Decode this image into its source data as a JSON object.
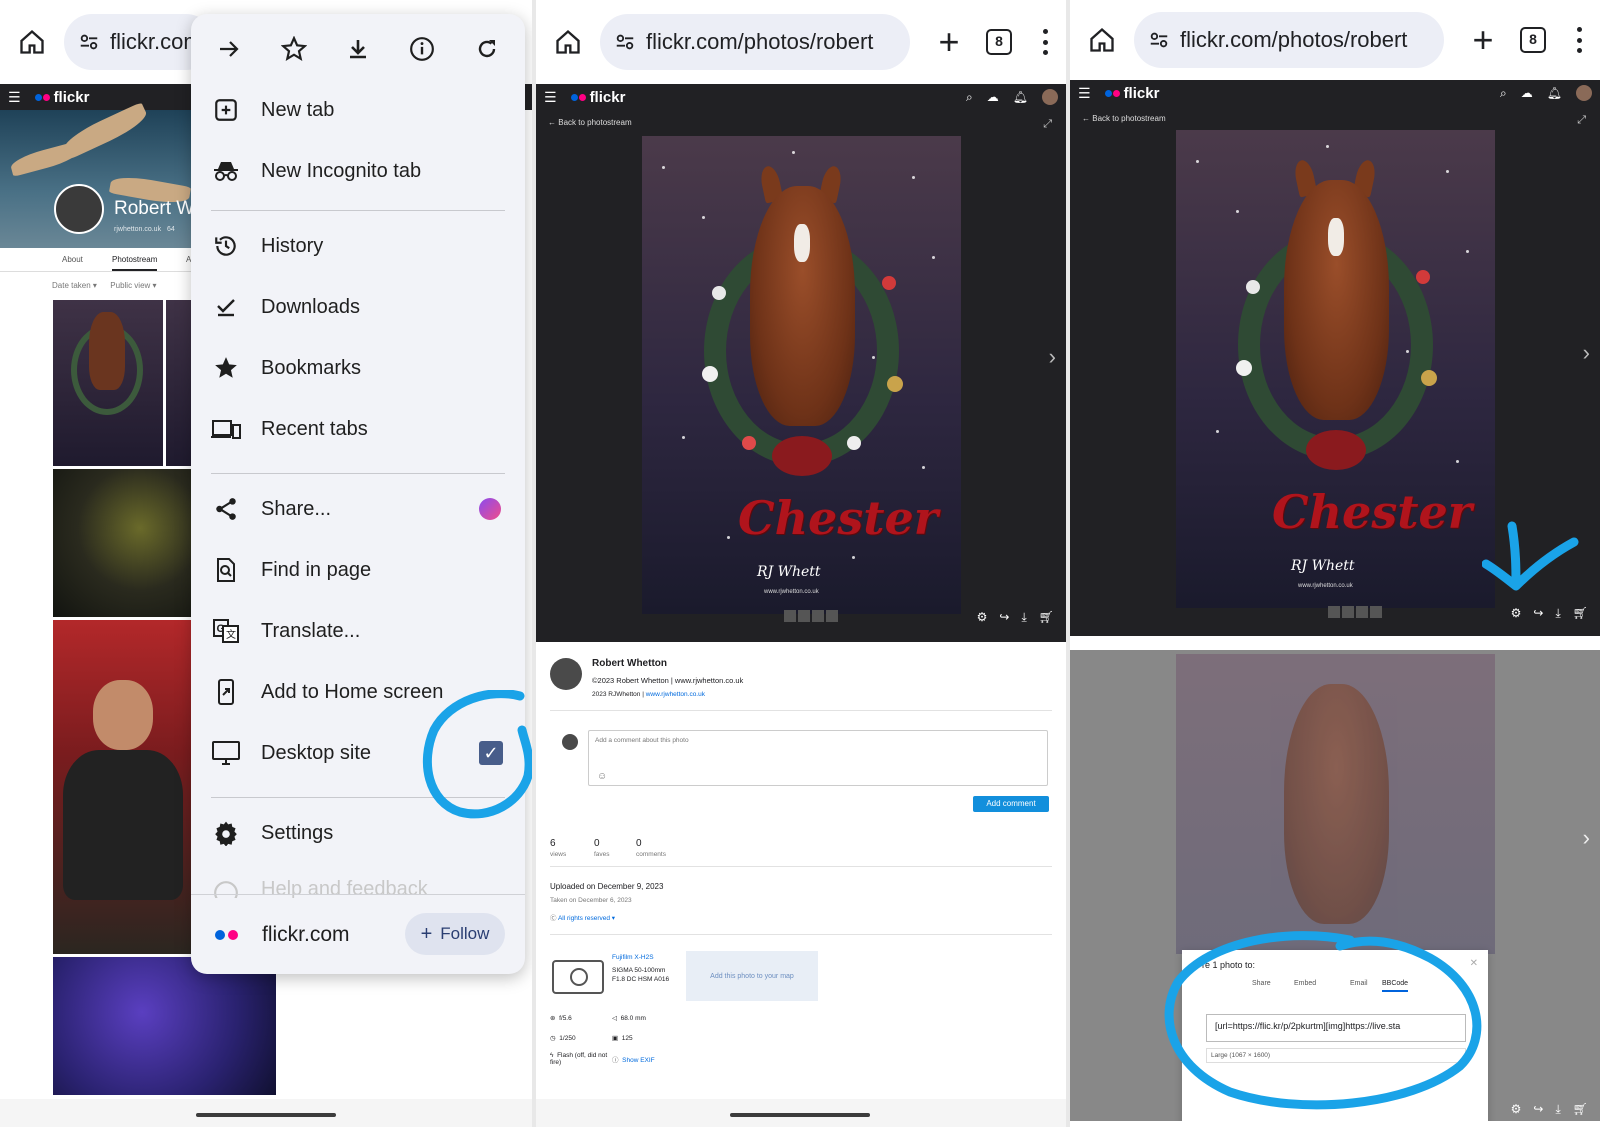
{
  "panel1": {
    "url": "flickr.com",
    "profile": {
      "name": "Robert W",
      "site": "rjwhetton.co.uk",
      "site_count": "64"
    },
    "tabs": [
      "About",
      "Photostream",
      "A"
    ],
    "filters": {
      "date": "Date taken ▾",
      "view": "Public view ▾"
    },
    "menu": {
      "top_icons": [
        "forward-icon",
        "star-icon",
        "download-icon",
        "info-icon",
        "reload-icon"
      ],
      "items": [
        {
          "label": "New tab",
          "icon": "new-tab-icon"
        },
        {
          "label": "New Incognito tab",
          "icon": "incognito-icon"
        },
        {
          "label": "History",
          "icon": "history-icon"
        },
        {
          "label": "Downloads",
          "icon": "downloads-icon"
        },
        {
          "label": "Bookmarks",
          "icon": "bookmarks-icon"
        },
        {
          "label": "Recent tabs",
          "icon": "recent-tabs-icon"
        },
        {
          "label": "Share...",
          "icon": "share-icon"
        },
        {
          "label": "Find in page",
          "icon": "find-icon"
        },
        {
          "label": "Translate...",
          "icon": "translate-icon"
        },
        {
          "label": "Add to Home screen",
          "icon": "add-home-icon"
        },
        {
          "label": "Desktop site",
          "icon": "desktop-icon",
          "checked": true
        },
        {
          "label": "Settings",
          "icon": "settings-icon"
        },
        {
          "label": "Help and feedback",
          "icon": "help-icon"
        }
      ],
      "footer": {
        "site": "flickr.com",
        "follow_label": "Follow"
      }
    }
  },
  "panel2": {
    "url": "flickr.com/photos/robert",
    "tab_count": "8",
    "brand": "flickr",
    "back_label": "Back to photostream",
    "photo": {
      "title_art": "Chester",
      "signature": "RJ Whett",
      "site": "www.rjwhetton.co.uk"
    },
    "owner": {
      "name": "Robert Whetton",
      "copyright": "©2023 Robert Whetton | www.rjwhetton.co.uk",
      "credit_prefix": "2023 RJWhetton |",
      "credit_link": "www.rjwhetton.co.uk"
    },
    "comment_placeholder": "Add a comment about this photo",
    "add_comment_label": "Add comment",
    "stats": [
      {
        "value": "6",
        "label": "views"
      },
      {
        "value": "0",
        "label": "faves"
      },
      {
        "value": "0",
        "label": "comments"
      }
    ],
    "uploaded": "Uploaded on December 9, 2023",
    "taken": "Taken on December 6, 2023",
    "license": "All rights reserved",
    "camera": {
      "model": "Fujifilm X-H2S",
      "lens": "SIGMA 50-100mm F1.8 DC HSM A016"
    },
    "map_label": "Add this photo to your map",
    "exif": {
      "aperture": "f/5.6",
      "focal": "68.0 mm",
      "shutter": "1/250",
      "iso": "125",
      "flash": "Flash (off, did not fire)",
      "show_exif": "Show EXIF"
    }
  },
  "panel3": {
    "url": "flickr.com/photos/robert",
    "tab_count": "8",
    "brand": "flickr",
    "back_label": "Back to photostream",
    "share": {
      "title": "re 1 photo to:",
      "tabs": [
        "Share",
        "Embed",
        "Email",
        "BBCode"
      ],
      "active_tab": "BBCode",
      "code": "[url=https://flic.kr/p/2pkurtm][img]https://live.sta",
      "size": "Large (1067 × 1600)"
    }
  },
  "colors": {
    "annotation": "#1aa3e8",
    "flickr_dark": "#212124",
    "flickr_blue": "#0063dc",
    "flickr_pink": "#ff0084",
    "checkbox": "#485d8a",
    "chester_red": "#b0141c"
  }
}
